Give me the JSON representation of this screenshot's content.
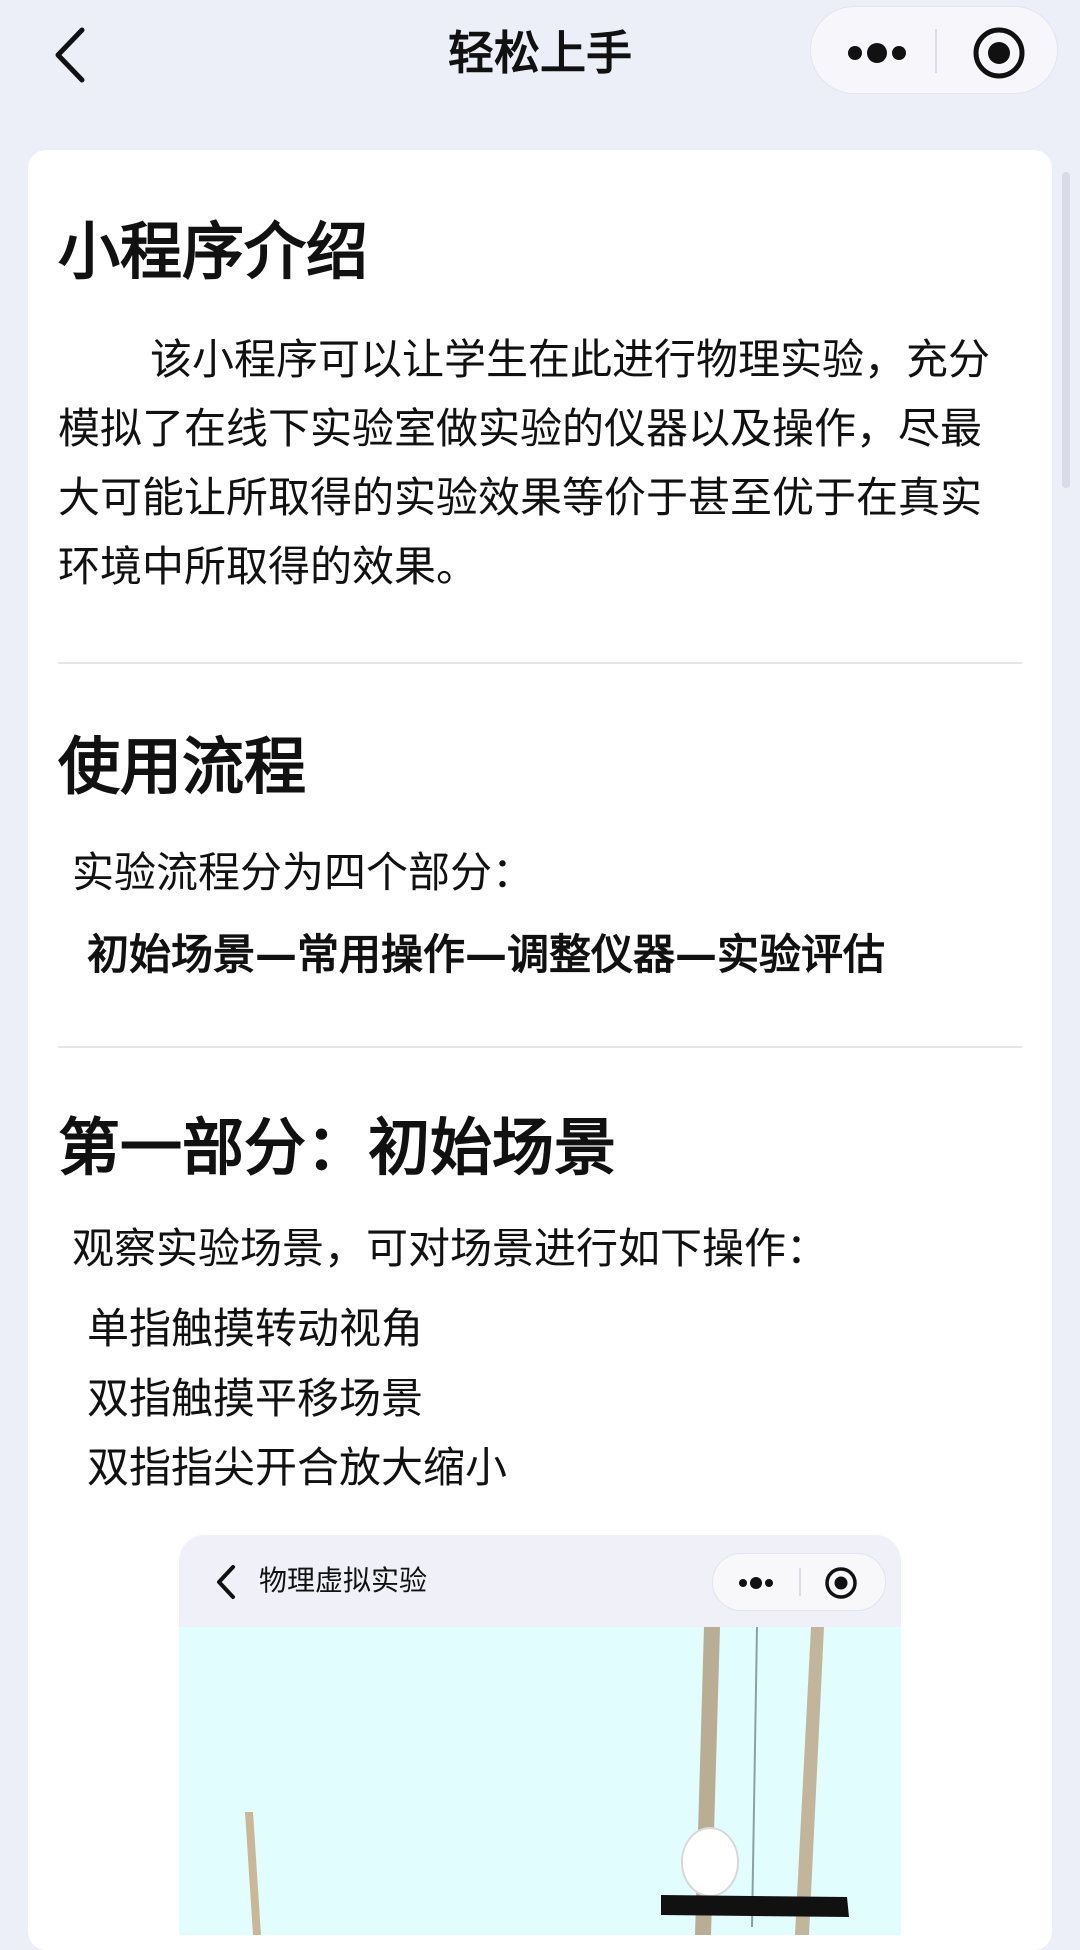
{
  "header": {
    "title": "轻松上手",
    "back_icon": "chevron-left-icon",
    "more_icon": "more-dots-icon",
    "close_icon": "record-circle-icon"
  },
  "sections": {
    "intro": {
      "heading": "小程序介绍",
      "body": "该小程序可以让学生在此进行物理实验，充分模拟了在线下实验室做实验的仪器以及操作，尽最大可能让所取得的实验效果等价于甚至优于在真实环境中所取得的效果。"
    },
    "flow": {
      "heading": "使用流程",
      "intro": "实验流程分为四个部分：",
      "steps": "初始场景—常用操作—调整仪器—实验评估"
    },
    "part1": {
      "heading": "第一部分：初始场景",
      "intro": "观察实验场景，可对场景进行如下操作：",
      "ops": [
        "单指触摸转动视角",
        "双指触摸平移场景",
        "双指指尖开合放大缩小"
      ]
    }
  },
  "screenshot": {
    "nav_title": "物理虚拟实验",
    "scene_bg": "#e2fdfe"
  },
  "colors": {
    "page_bg": "#eceef8",
    "card_bg": "#ffffff",
    "text": "#111111"
  }
}
